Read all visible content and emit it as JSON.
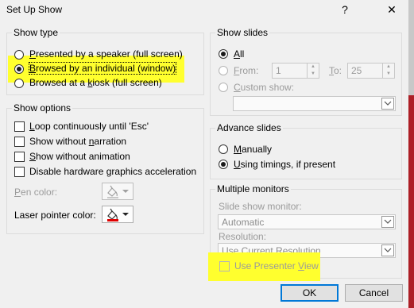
{
  "window": {
    "title": "Set Up Show",
    "help_glyph": "?",
    "close_glyph": "✕"
  },
  "show_type": {
    "legend": "Show type",
    "options": [
      {
        "pre": "",
        "key": "P",
        "post": "resented by a speaker (full screen)",
        "checked": false
      },
      {
        "pre": "",
        "key": "B",
        "post": "rowsed by an individual (window)",
        "checked": true
      },
      {
        "pre": "Browsed at a ",
        "key": "k",
        "post": "iosk (full screen)",
        "checked": false
      }
    ]
  },
  "show_options": {
    "legend": "Show options",
    "checkboxes": [
      {
        "pre": "",
        "key": "L",
        "post": "oop continuously until 'Esc'"
      },
      {
        "pre": "Show without ",
        "key": "n",
        "post": "arration"
      },
      {
        "pre": "",
        "key": "S",
        "post": "how without animation"
      },
      {
        "pre": "Disable hardware ",
        "key": "g",
        "post": "raphics acceleration"
      }
    ],
    "pen_color": {
      "pre": "",
      "key": "P",
      "post": "en color:"
    },
    "laser_color": {
      "pre": "Laser pointer color:",
      "key": "",
      "post": ""
    },
    "laser_swatch": "#e00000"
  },
  "show_slides": {
    "legend": "Show slides",
    "all": {
      "pre": "",
      "key": "A",
      "post": "ll"
    },
    "from": {
      "pre": "",
      "key": "F",
      "post": "rom:"
    },
    "from_value": "1",
    "to": {
      "pre": "",
      "key": "T",
      "post": "o:"
    },
    "to_value": "25",
    "custom": {
      "pre": "",
      "key": "C",
      "post": "ustom show:"
    },
    "custom_value": ""
  },
  "advance_slides": {
    "legend": "Advance slides",
    "manually": {
      "pre": "",
      "key": "M",
      "post": "anually"
    },
    "timings": {
      "pre": "",
      "key": "U",
      "post": "sing timings, if present"
    }
  },
  "monitors": {
    "legend": "Multiple monitors",
    "slide_show_monitor_label": "Slide show monitor:",
    "monitor_value": "Automatic",
    "resolution_label": "Resolution:",
    "resolution_value": "Use Current Resolution",
    "presenter_view": {
      "pre": "Use Presenter ",
      "key": "V",
      "post": "iew"
    }
  },
  "buttons": {
    "ok": "OK",
    "cancel": "Cancel"
  },
  "colors": {
    "highlight": "#ffff2e",
    "default_button_border": "#0078d7",
    "background_slide": "#ad1f26"
  }
}
